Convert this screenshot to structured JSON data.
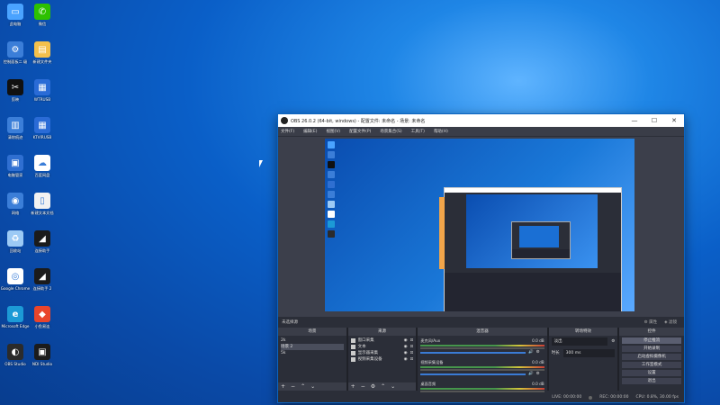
{
  "desktop": {
    "icons": [
      {
        "label": "此电脑",
        "color": "#4aa3ff",
        "glyph": "▭",
        "icon": "computer-icon"
      },
      {
        "label": "微信",
        "color": "#2dc100",
        "glyph": "✆",
        "icon": "wechat-icon"
      },
      {
        "label": "控制面板二\n级",
        "color": "#3b7ed8",
        "glyph": "⚙",
        "icon": "control-panel-icon"
      },
      {
        "label": "新建文件夹",
        "color": "#f3c04c",
        "glyph": "▤",
        "icon": "folder-icon"
      },
      {
        "label": "剪映",
        "color": "#111111",
        "glyph": "✂",
        "icon": "capcut-icon"
      },
      {
        "label": "WTRUSB",
        "color": "#2a6bd6",
        "glyph": "▦",
        "icon": "usb-app-icon"
      },
      {
        "label": "清除痕迹",
        "color": "#3b7ed8",
        "glyph": "▥",
        "icon": "cleaner-icon"
      },
      {
        "label": "KTVIRUSB",
        "color": "#2a6bd6",
        "glyph": "▦",
        "icon": "usb-app-icon"
      },
      {
        "label": "电脑管家",
        "color": "#2f6fd1",
        "glyph": "▣",
        "icon": "pc-manager-icon"
      },
      {
        "label": "百度网盘",
        "color": "#ffffff",
        "glyph": "☁",
        "icon": "baidu-pan-icon"
      },
      {
        "label": "网络",
        "color": "#3b7ed8",
        "glyph": "◉",
        "icon": "network-icon"
      },
      {
        "label": "新建文本文档",
        "color": "#f2f2f2",
        "glyph": "▯",
        "icon": "text-file-icon"
      },
      {
        "label": "回收站",
        "color": "#9ccaf5",
        "glyph": "♻",
        "icon": "recycle-bin-icon"
      },
      {
        "label": "连接助手",
        "color": "#1b1b1b",
        "glyph": "◢",
        "icon": "connector-icon"
      },
      {
        "label": "Google\nChrome",
        "color": "#ffffff",
        "glyph": "◎",
        "icon": "chrome-icon"
      },
      {
        "label": "连接助手\n2",
        "color": "#1b1b1b",
        "glyph": "◢",
        "icon": "connector-icon"
      },
      {
        "label": "Microsoft\nEdge",
        "color": "#1c9ad6",
        "glyph": "e",
        "icon": "edge-icon"
      },
      {
        "label": "小鱼易连",
        "color": "#e9452b",
        "glyph": "◆",
        "icon": "app-icon"
      },
      {
        "label": "OBS Studio",
        "color": "#2b2b2b",
        "glyph": "◐",
        "icon": "obs-icon"
      },
      {
        "label": "NDI Studio",
        "color": "#1b1b1b",
        "glyph": "▣",
        "icon": "ndi-icon"
      }
    ]
  },
  "obs": {
    "title": "OBS 26.0.2 (64-bit, windows) - 配置文件: 未命名 - 场景: 未命名",
    "menu": [
      "文件(F)",
      "编辑(E)",
      "视图(V)",
      "配置文件(P)",
      "场景集合(S)",
      "工具(T)",
      "帮助(H)"
    ],
    "controls_bar": {
      "label": "未选择源",
      "properties": "属性",
      "filters": "滤镜"
    },
    "scenes": {
      "title": "场景",
      "items": [
        "2k",
        "场景 2",
        "5k"
      ],
      "selected_index": 1
    },
    "sources": {
      "title": "来源",
      "items": [
        "窗口采集",
        "文本",
        "显示器采集",
        "视频采集设备"
      ]
    },
    "mixer": {
      "title": "混音器",
      "channels": [
        {
          "name": "麦克风/Aux",
          "db": "0.0 dB"
        },
        {
          "name": "视频采集设备",
          "db": "0.0 dB"
        },
        {
          "name": "桌面音频",
          "db": "0.0 dB"
        }
      ]
    },
    "transitions": {
      "title": "转场特效",
      "type": "淡出",
      "duration_label": "时长",
      "duration": "300 ms"
    },
    "controls": {
      "title": "控件",
      "buttons": [
        "停止推流",
        "开始录制",
        "启动虚拟摄像机",
        "工作室模式",
        "设置",
        "退出"
      ]
    },
    "status": {
      "live": "LIVE: 00:00:00",
      "rec": "REC: 00:00:00",
      "cpu": "CPU: 0.8%, 30.00 fps"
    }
  }
}
